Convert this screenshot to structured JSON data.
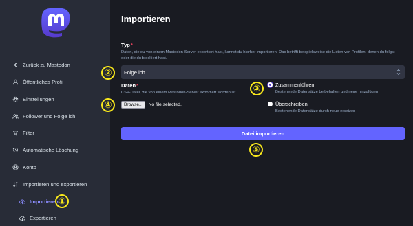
{
  "sidebar": {
    "items": [
      {
        "label": "Zurück zu Mastodon",
        "icon": "chevron-left-icon"
      },
      {
        "label": "Öffentliches Profil",
        "icon": "person-icon"
      },
      {
        "label": "Einstellungen",
        "icon": "gear-icon"
      },
      {
        "label": "Follower und Folge ich",
        "icon": "users-icon"
      },
      {
        "label": "Filter",
        "icon": "filter-icon"
      },
      {
        "label": "Automatische Löschung",
        "icon": "history-icon"
      },
      {
        "label": "Konto",
        "icon": "user-circle-icon"
      },
      {
        "label": "Importieren und exportieren",
        "icon": "import-export-icon"
      },
      {
        "label": "Importieren",
        "icon": "cloud-upload-icon",
        "active": true
      },
      {
        "label": "Exportieren",
        "icon": "cloud-download-icon"
      }
    ]
  },
  "main": {
    "title": "Importieren",
    "type_field": {
      "label": "Typ",
      "required_mark": "*",
      "hint": "Daten, die du von einem Mastodon-Server exportiert hast, kannst du hierher importieren. Das betrifft beispielsweise die Listen von Profilen, denen du folgst oder die du blockiert hast.",
      "value": "Folge ich"
    },
    "data_field": {
      "label": "Daten",
      "required_mark": "*",
      "hint": "CSV-Datei, die von einem Mastodon-Server exportiert worden ist",
      "browse_label": "Browse...",
      "file_status": "No file selected."
    },
    "mode": {
      "options": [
        {
          "label": "Zusammenführen",
          "hint": "Bestehende Datensätze beibehalten und neue hinzufügen",
          "checked": true
        },
        {
          "label": "Überschreiben",
          "hint": "Bestehende Datensätze durch neue ersetzen",
          "checked": false
        }
      ]
    },
    "submit_label": "Datei importieren"
  },
  "callouts": [
    "①",
    "②",
    "③",
    "④",
    "⑤"
  ],
  "colors": {
    "accent": "#6364ff",
    "active_nav": "#8c8dff",
    "sidebar_bg": "#282c37",
    "main_bg": "#191b22",
    "callout": "#f8e71c",
    "required": "#df405a"
  }
}
